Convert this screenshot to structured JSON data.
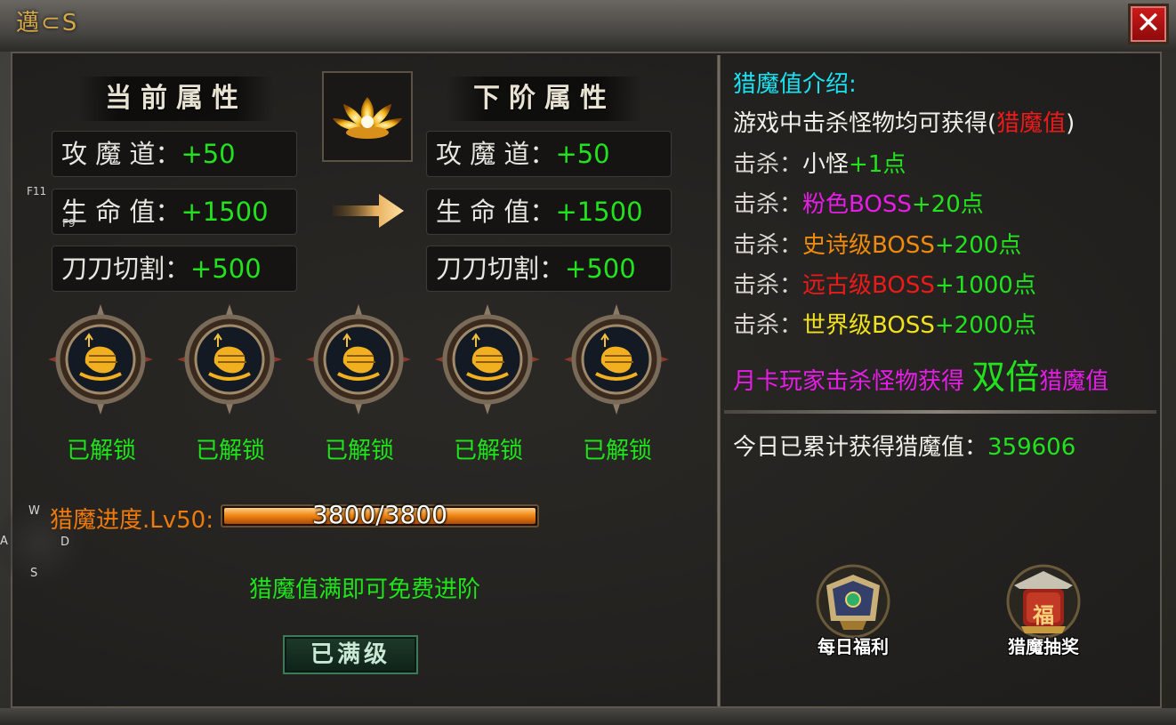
{
  "window": {
    "logo_text": "邁⊂S",
    "close_glyph": "✕"
  },
  "left": {
    "current_title": "当前属性",
    "next_title": "下阶属性",
    "current_stats": [
      {
        "name": "攻 魔 道：",
        "value": "+50"
      },
      {
        "name": "生 命 值：",
        "value": "+1500"
      },
      {
        "name": "刀刀切割：",
        "value": "+500"
      }
    ],
    "next_stats": [
      {
        "name": "攻 魔 道：",
        "value": "+50"
      },
      {
        "name": "生 命 值：",
        "value": "+1500"
      },
      {
        "name": "刀刀切割：",
        "value": "+500"
      }
    ],
    "hints": {
      "f11": "F11",
      "f9": "F9"
    },
    "unlocks": [
      "已解锁",
      "已解锁",
      "已解锁",
      "已解锁",
      "已解锁"
    ],
    "progress": {
      "label": "猎魔进度.Lv50:",
      "current": 3800,
      "max": 3800,
      "text": "3800/3800"
    },
    "wasd": {
      "w": "W",
      "a": "A",
      "s": "S",
      "d": "D"
    },
    "free_text": "猎魔值满即可免费进阶",
    "max_button": "已满级"
  },
  "right": {
    "intro_title": "猎魔值介绍:",
    "intro_line": {
      "before": "游戏中击杀怪物均可获得(",
      "highlight": "猎魔值",
      "after": ")"
    },
    "kills": [
      {
        "prefix": "击杀：",
        "target": "小怪",
        "points": "+1点",
        "target_color": "#f0efe8"
      },
      {
        "prefix": "击杀：",
        "target": "粉色BOSS",
        "points": "+20点",
        "target_color": "#e81ce8"
      },
      {
        "prefix": "击杀：",
        "target": "史诗级BOSS",
        "points": "+200点",
        "target_color": "#f08a0a"
      },
      {
        "prefix": "击杀：",
        "target": "远古级BOSS",
        "points": "+1000点",
        "target_color": "#ee1a1a"
      },
      {
        "prefix": "击杀：",
        "target": "世界级BOSS",
        "points": "+2000点",
        "target_color": "#f0e21a"
      }
    ],
    "monthly": {
      "before": "月卡玩家击杀怪物获得 ",
      "double": "双倍",
      "after": "猎魔值"
    },
    "today": {
      "label": "今日已累计获得猎魔值：",
      "value": "359606"
    },
    "buttons": [
      {
        "label": "每日福利",
        "icon": "daily-welfare-icon"
      },
      {
        "label": "猎魔抽奖",
        "icon": "lottery-icon",
        "badge": "福"
      }
    ]
  }
}
